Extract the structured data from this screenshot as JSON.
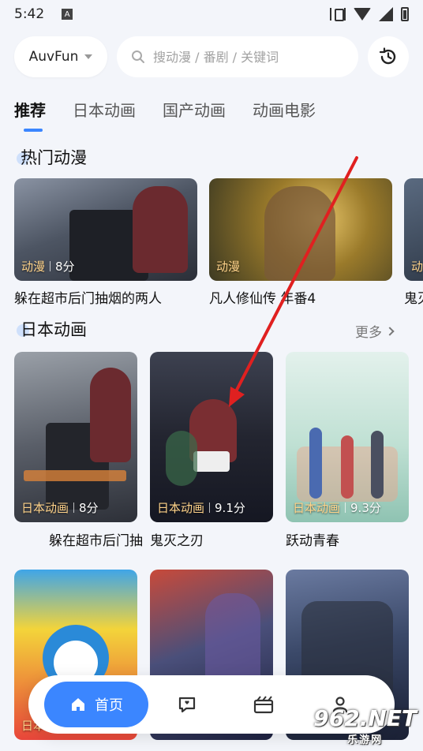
{
  "status": {
    "time": "5:42"
  },
  "header": {
    "site_name": "AuvFun",
    "search_placeholder": "搜动漫 / 番剧 / 关键词"
  },
  "tabs": [
    {
      "label": "推荐"
    },
    {
      "label": "日本动画"
    },
    {
      "label": "国产动画"
    },
    {
      "label": "动画电影"
    }
  ],
  "hot": {
    "title": "热门动漫",
    "items": [
      {
        "category": "动漫",
        "score": "8分",
        "title": "躲在超市后门抽烟的两人",
        "color": "#5f6a7a"
      },
      {
        "category": "动漫",
        "score": "",
        "title": "凡人修仙传 年番4",
        "color": "#b79a3a"
      },
      {
        "category": "动",
        "score": "",
        "title": "鬼灭",
        "color": "#3c4a5e"
      }
    ]
  },
  "japan": {
    "title": "日本动画",
    "more_label": "更多",
    "items": [
      {
        "category": "日本动画",
        "score": "8分",
        "title": "躲在超市后门抽",
        "color": "#6a6c72"
      },
      {
        "category": "日本动画",
        "score": "9.1分",
        "title": "鬼灭之刃",
        "color": "#2c2f3a"
      },
      {
        "category": "日本动画",
        "score": "9.3分",
        "title": "跃动青春",
        "color": "#b9dbd2"
      },
      {
        "category": "日本",
        "score": "",
        "title": "",
        "color": "#e8463a"
      },
      {
        "category": "",
        "score": "",
        "title": "",
        "color": "#4a4f7a"
      },
      {
        "category": "",
        "score": "",
        "title": "",
        "color": "#3a4868"
      }
    ]
  },
  "bottom_nav": {
    "home_label": "首页"
  },
  "watermark": {
    "text": "962.NET",
    "sub": "乐游网"
  },
  "colors": {
    "accent": "#3b86ff",
    "tag": "#ffd38a"
  }
}
